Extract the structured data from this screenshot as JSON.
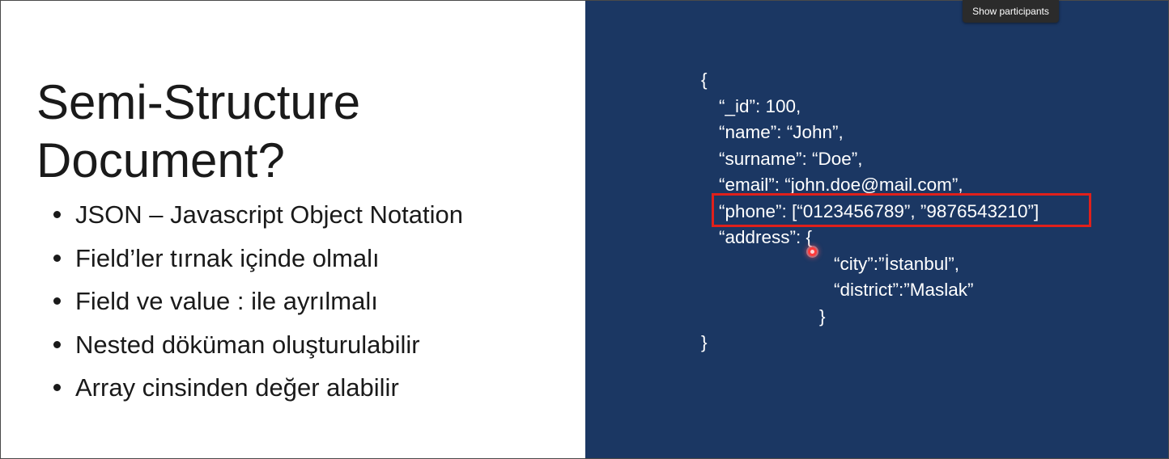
{
  "slide": {
    "title_lines": [
      "Semi-Structure",
      "Document?"
    ],
    "bullets": [
      "JSON – Javascript Object Notation",
      "Field’ler tırnak içinde olmalı",
      "Field ve value : ile ayrılmalı",
      "Nested döküman oluşturulabilir",
      "Array cinsinden değer alabilir"
    ],
    "code_lines": [
      "{",
      "“_id”: 100,",
      "“name”: “John”,",
      "“surname”: “Doe”,",
      "“email”: “john.doe@mail.com”,",
      "“phone”: [“0123456789”, ”9876543210”]",
      "“address”: {",
      "“city”:”İstanbul”,",
      "“district”:”Maslak”",
      "}",
      "}"
    ]
  },
  "overlay": {
    "tooltip": "Show participants"
  },
  "colors": {
    "right_panel_bg": "#1b3763",
    "highlight_border": "#e0201b",
    "laser_pointer": "#ff3b3b"
  }
}
